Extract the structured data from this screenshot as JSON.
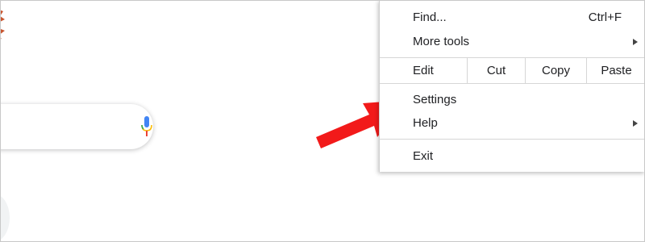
{
  "menu": {
    "find_label": "Find...",
    "find_shortcut": "Ctrl+F",
    "more_tools_label": "More tools",
    "edit_label": "Edit",
    "cut_label": "Cut",
    "copy_label": "Copy",
    "paste_label": "Paste",
    "settings_label": "Settings",
    "help_label": "Help",
    "exit_label": "Exit"
  },
  "colors": {
    "arrow": "#f21a1a",
    "mic_blue": "#4285f4",
    "mic_red": "#ea4335",
    "doodle": "#c8552f"
  }
}
